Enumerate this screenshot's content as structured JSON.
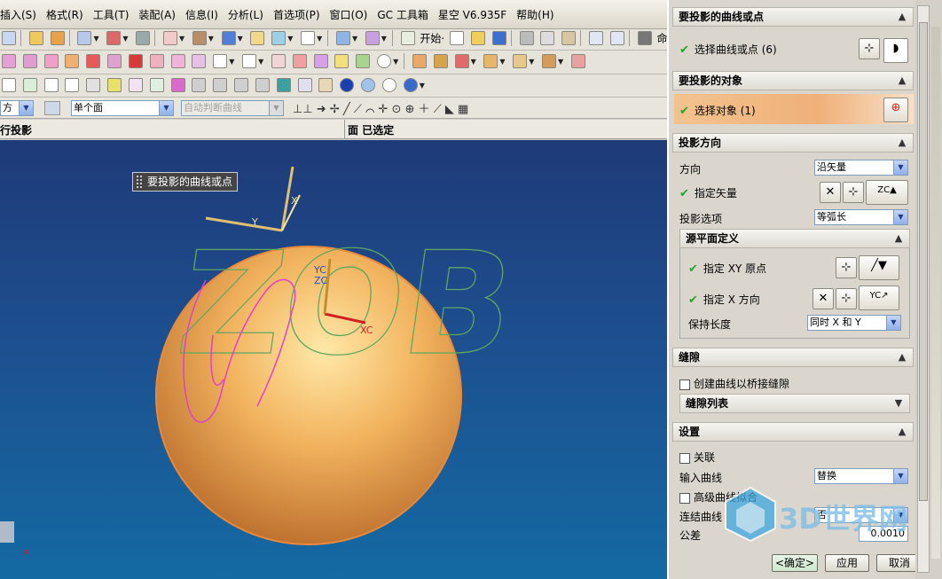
{
  "menu": [
    "插入(S)",
    "格式(R)",
    "工具(T)",
    "装配(A)",
    "信息(I)",
    "分析(L)",
    "首选项(P)",
    "窗口(O)",
    "GC 工具箱",
    "星空 V6.935F",
    "帮助(H)"
  ],
  "toolbar": {
    "start_label": "开始·",
    "command_label": "命令"
  },
  "selection": {
    "filter_partial": "方",
    "scope": "单个面",
    "curve_rule": "自动判断曲线"
  },
  "column_header": {
    "left": "行投影",
    "right": "面 已选定"
  },
  "viewport": {
    "tooltip": "要投影的曲线或点",
    "axis_labels": {
      "x": "X",
      "y": "Y",
      "yc": "YC",
      "zc": "ZC",
      "xc": "XC",
      "small_x": "X"
    },
    "text_shape": "ZOB"
  },
  "panel": {
    "sec_curves": "要投影的曲线或点",
    "row_curves": "选择曲线或点 (6)",
    "sec_objects": "要投影的对象",
    "row_objects": "选择对象 (1)",
    "sec_direction": "投影方向",
    "dir_label": "方向",
    "dir_value": "沿矢量",
    "vector_label": "指定矢量",
    "proj_option_label": "投影选项",
    "proj_option_value": "等弧长",
    "sub_source_plane": "源平面定义",
    "xy_origin_label": "指定 XY 原点",
    "x_dir_label": "指定 X 方向",
    "keep_len_label": "保持长度",
    "keep_len_value": "同时 X 和 Y",
    "sec_gap": "缝隙",
    "bridge_label": "创建曲线以桥接缝隙",
    "gap_list": "缝隙列表",
    "sec_settings": "设置",
    "assoc_label": "关联",
    "input_curve_label": "输入曲线",
    "input_curve_value": "替换",
    "adv_fit_label": "高级曲线拟合",
    "join_label": "连结曲线",
    "join_value": "否",
    "tol_label": "公差",
    "tol_value": "0.0010",
    "ok": "<确定>",
    "apply": "应用",
    "cancel": "取消"
  },
  "watermark": "3D世界网"
}
